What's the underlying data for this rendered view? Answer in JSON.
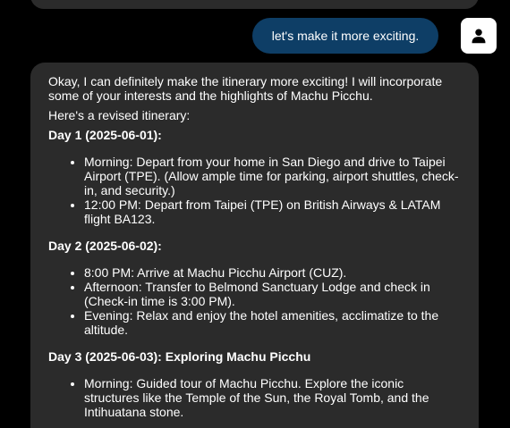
{
  "chat": {
    "user_message": "let's make it more exciting.",
    "assistant": {
      "intro": "Okay, I can definitely make the itinerary more exciting! I will incorporate some of your interests and the highlights of Machu Picchu.",
      "revised_label": "Here's a revised itinerary:",
      "days": [
        {
          "heading": "Day 1 (2025-06-01):",
          "items": [
            "Morning: Depart from your home in San Diego and drive to Taipei Airport (TPE). (Allow ample time for parking, airport shuttles, check-in, and security.)",
            "12:00 PM: Depart from Taipei (TPE) on British Airways & LATAM flight BA123."
          ]
        },
        {
          "heading": "Day 2 (2025-06-02):",
          "items": [
            "8:00 PM: Arrive at Machu Picchu Airport (CUZ).",
            "Afternoon: Transfer to Belmond Sanctuary Lodge and check in (Check-in time is 3:00 PM).",
            "Evening: Relax and enjoy the hotel amenities, acclimatize to the altitude."
          ]
        },
        {
          "heading": "Day 3 (2025-06-03): Exploring Machu Picchu",
          "items": [
            "Morning: Guided tour of Machu Picchu. Explore the iconic structures like the Temple of the Sun, the Royal Tomb, and the Intihuatana stone."
          ]
        }
      ]
    }
  },
  "icons": {
    "avatar": "person-icon"
  },
  "colors": {
    "background": "#000000",
    "assistant_bubble": "#2b2b2b",
    "user_bubble": "#0e3e66",
    "avatar_bg": "#ffffff"
  }
}
